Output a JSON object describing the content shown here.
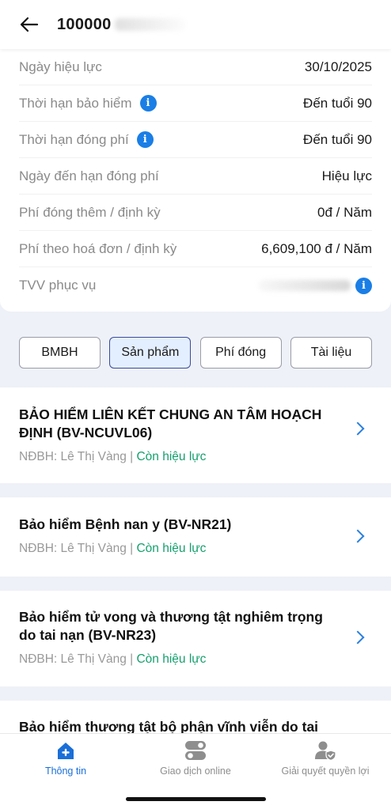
{
  "header": {
    "title": "100000"
  },
  "info_rows": [
    {
      "label": "Ngày hiệu lực",
      "value": "30/10/2025"
    },
    {
      "label": "Thời hạn bảo hiểm",
      "value": "Đến tuổi 90"
    },
    {
      "label": "Thời hạn đóng phí",
      "value": "Đến tuổi 90"
    },
    {
      "label": "Ngày đến hạn đóng phí",
      "value": "Hiệu lực"
    },
    {
      "label": "Phí đóng thêm / định kỳ",
      "value": "0đ / Năm"
    },
    {
      "label": "Phí theo hoá đơn / định kỳ",
      "value": "6,609,100 đ / Năm"
    },
    {
      "label": "TVV phục vụ",
      "value": ""
    }
  ],
  "tabs": [
    "BMBH",
    "Sản phẩm",
    "Phí đóng",
    "Tài liệu"
  ],
  "products": [
    {
      "title": "BẢO HIỂM LIÊN KẾT CHUNG AN TÂM HOẠCH ĐỊNH (BV-NCUVL06)",
      "insured": "NĐBH: Lê Thị Vàng | ",
      "status": "Còn hiệu lực"
    },
    {
      "title": "Bảo hiểm Bệnh nan y (BV-NR21)",
      "insured": "NĐBH: Lê Thị Vàng | ",
      "status": "Còn hiệu lực"
    },
    {
      "title": "Bảo hiểm tử vong và thương tật nghiêm trọng do tai nạn (BV-NR23)",
      "insured": "NĐBH: Lê Thị Vàng | ",
      "status": "Còn hiệu lực"
    },
    {
      "title": "Bảo hiểm thương tật bộ phận vĩnh viễn do tai nạn",
      "insured": "",
      "status": ""
    }
  ],
  "bottom_nav": [
    {
      "label": "Thông tin",
      "icon": "home-icon"
    },
    {
      "label": "Giao dịch online",
      "icon": "toggles-icon"
    },
    {
      "label": "Giải quyết quyền lợi",
      "icon": "user-shield-icon"
    }
  ],
  "colors": {
    "accent": "#1a6fd8",
    "status_green": "#15a06e",
    "info_icon": "#1a7ee6"
  }
}
